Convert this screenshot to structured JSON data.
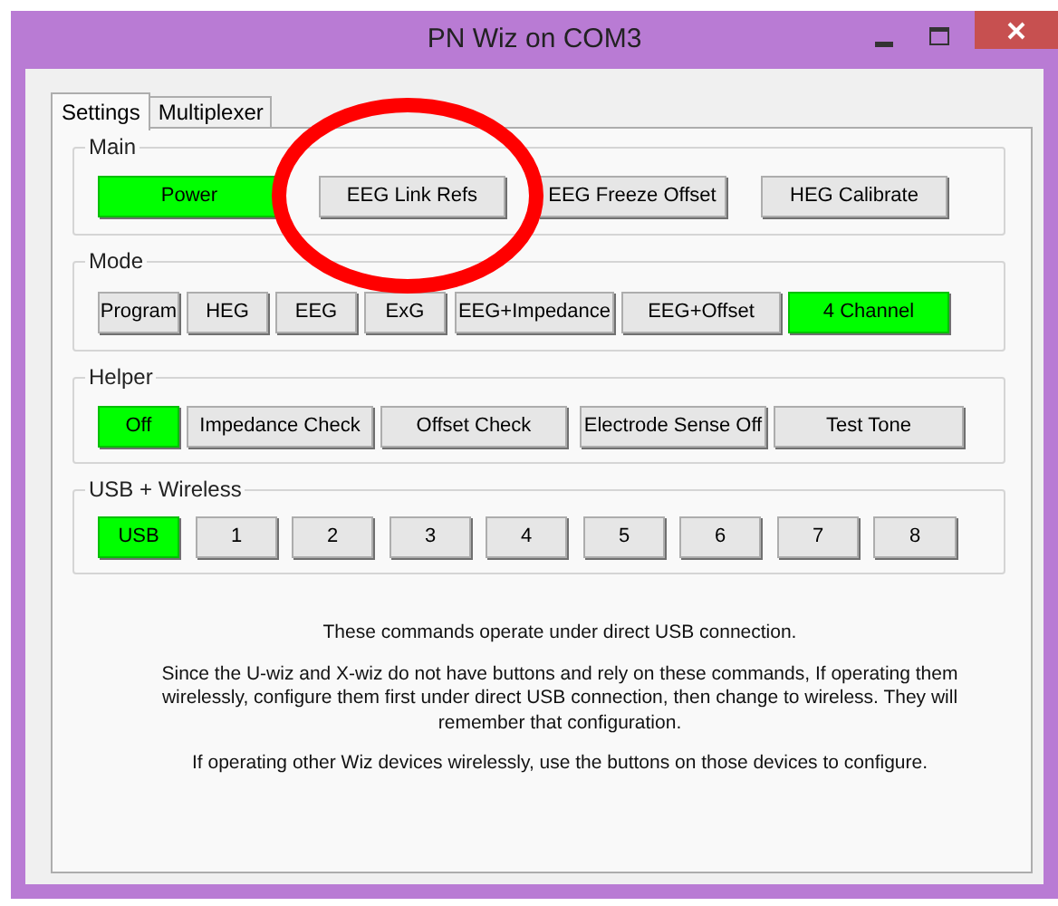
{
  "window": {
    "title": "PN Wiz on COM3"
  },
  "tabs": [
    {
      "label": "Settings",
      "selected": true
    },
    {
      "label": "Multiplexer",
      "selected": false
    }
  ],
  "groups": [
    {
      "label": "Main",
      "buttons": [
        {
          "label": "Power",
          "selected": true
        },
        {
          "label": "EEG Link Refs",
          "selected": false
        },
        {
          "label": "EEG Freeze Offset",
          "selected": false
        },
        {
          "label": "HEG Calibrate",
          "selected": false
        }
      ]
    },
    {
      "label": "Mode",
      "buttons": [
        {
          "label": "Program",
          "selected": false
        },
        {
          "label": "HEG",
          "selected": false
        },
        {
          "label": "EEG",
          "selected": false
        },
        {
          "label": "ExG",
          "selected": false
        },
        {
          "label": "EEG+Impedance",
          "selected": false
        },
        {
          "label": "EEG+Offset",
          "selected": false
        },
        {
          "label": "4 Channel",
          "selected": true
        }
      ]
    },
    {
      "label": "Helper",
      "buttons": [
        {
          "label": "Off",
          "selected": true
        },
        {
          "label": "Impedance Check",
          "selected": false
        },
        {
          "label": "Offset Check",
          "selected": false
        },
        {
          "label": "Electrode Sense Off",
          "selected": false
        },
        {
          "label": "Test Tone",
          "selected": false
        }
      ]
    },
    {
      "label": "USB + Wireless",
      "buttons": [
        {
          "label": "USB",
          "selected": true
        },
        {
          "label": "1",
          "selected": false
        },
        {
          "label": "2",
          "selected": false
        },
        {
          "label": "3",
          "selected": false
        },
        {
          "label": "4",
          "selected": false
        },
        {
          "label": "5",
          "selected": false
        },
        {
          "label": "6",
          "selected": false
        },
        {
          "label": "7",
          "selected": false
        },
        {
          "label": "8",
          "selected": false
        }
      ]
    }
  ],
  "notes": [
    "These commands operate under direct USB connection.",
    "Since the U-wiz and X-wiz do not have buttons and rely on these commands, If operating them wirelessly, configure them first under direct USB connection, then change to wireless. They will remember that configuration.",
    "If operating other Wiz devices wirelessly, use the buttons on those devices to configure."
  ],
  "annotations": [
    {
      "kind": "ellipse"
    }
  ]
}
